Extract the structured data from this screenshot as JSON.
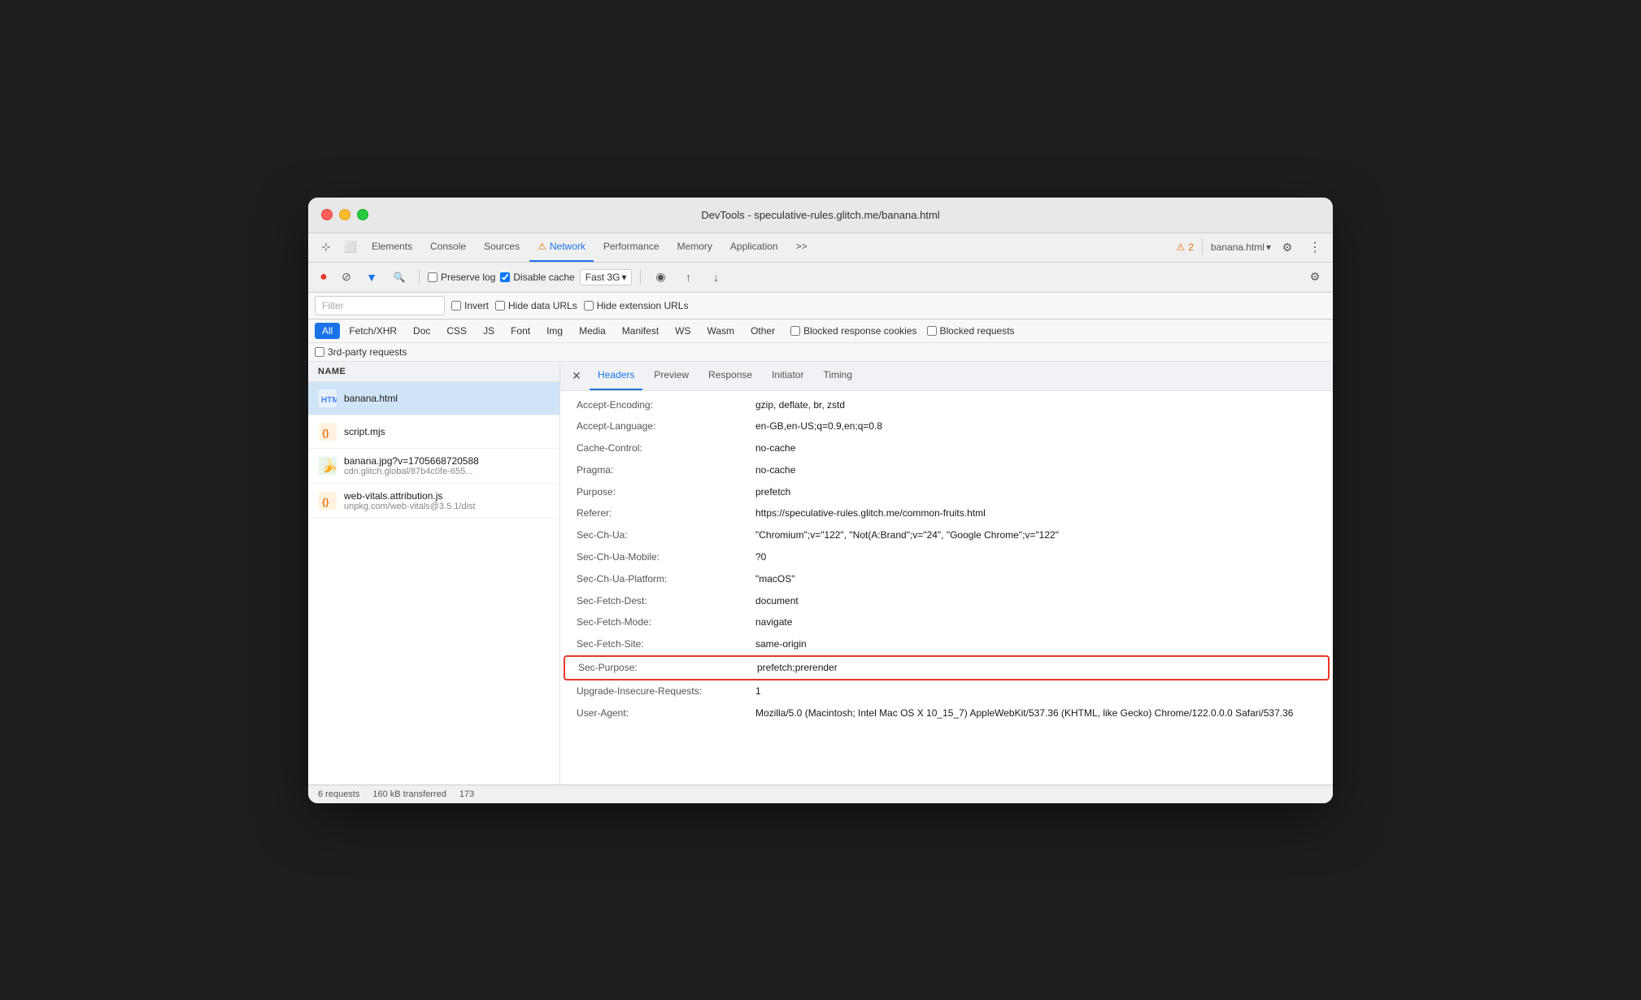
{
  "window": {
    "title": "DevTools - speculative-rules.glitch.me/banana.html"
  },
  "topToolbar": {
    "tabs": [
      {
        "label": "Elements",
        "active": false
      },
      {
        "label": "Console",
        "active": false
      },
      {
        "label": "Sources",
        "active": false
      },
      {
        "label": "Network",
        "active": true,
        "hasWarning": true
      },
      {
        "label": "Performance",
        "active": false
      },
      {
        "label": "Memory",
        "active": false
      },
      {
        "label": "Application",
        "active": false
      }
    ],
    "more_label": ">>",
    "warning_count": "2",
    "page_selector": "banana.html",
    "settings_label": "⚙",
    "more_icon_label": "⋮"
  },
  "secondToolbar": {
    "preserve_log_label": "Preserve log",
    "disable_cache_label": "Disable cache",
    "disable_cache_checked": true,
    "throttle_label": "Fast 3G"
  },
  "filterToolbar": {
    "filter_placeholder": "Filter",
    "invert_label": "Invert",
    "hide_data_urls_label": "Hide data URLs",
    "hide_extension_urls_label": "Hide extension URLs"
  },
  "filterTabs": {
    "tabs": [
      {
        "label": "All",
        "active": true
      },
      {
        "label": "Fetch/XHR",
        "active": false
      },
      {
        "label": "Doc",
        "active": false
      },
      {
        "label": "CSS",
        "active": false
      },
      {
        "label": "JS",
        "active": false
      },
      {
        "label": "Font",
        "active": false
      },
      {
        "label": "Img",
        "active": false
      },
      {
        "label": "Media",
        "active": false
      },
      {
        "label": "Manifest",
        "active": false
      },
      {
        "label": "WS",
        "active": false
      },
      {
        "label": "Wasm",
        "active": false
      },
      {
        "label": "Other",
        "active": false
      }
    ],
    "blocked_response_cookies_label": "Blocked response cookies",
    "blocked_requests_label": "Blocked requests"
  },
  "thirdParty": {
    "label": "3rd-party requests"
  },
  "fileList": {
    "header": "Name",
    "files": [
      {
        "name": "banana.html",
        "url": "",
        "icon_type": "html",
        "active": true
      },
      {
        "name": "script.mjs",
        "url": "",
        "icon_type": "js",
        "active": false
      },
      {
        "name": "banana.jpg?v=1705668720588",
        "url": "cdn.glitch.global/87b4c0fe-655...",
        "icon_type": "img",
        "active": false
      },
      {
        "name": "web-vitals.attribution.js",
        "url": "unpkg.com/web-vitals@3.5.1/dist",
        "icon_type": "js",
        "active": false
      }
    ]
  },
  "headersPanel": {
    "close_btn_label": "✕",
    "tabs": [
      {
        "label": "Headers",
        "active": true
      },
      {
        "label": "Preview",
        "active": false
      },
      {
        "label": "Response",
        "active": false
      },
      {
        "label": "Initiator",
        "active": false
      },
      {
        "label": "Timing",
        "active": false
      }
    ],
    "headers": [
      {
        "name": "Accept-Encoding:",
        "value": "gzip, deflate, br, zstd",
        "highlighted": false
      },
      {
        "name": "Accept-Language:",
        "value": "en-GB,en-US;q=0.9,en;q=0.8",
        "highlighted": false
      },
      {
        "name": "Cache-Control:",
        "value": "no-cache",
        "highlighted": false
      },
      {
        "name": "Pragma:",
        "value": "no-cache",
        "highlighted": false
      },
      {
        "name": "Purpose:",
        "value": "prefetch",
        "highlighted": false
      },
      {
        "name": "Referer:",
        "value": "https://speculative-rules.glitch.me/common-fruits.html",
        "highlighted": false
      },
      {
        "name": "Sec-Ch-Ua:",
        "value": "\"Chromium\";v=\"122\", \"Not(A:Brand\";v=\"24\", \"Google Chrome\";v=\"122\"",
        "highlighted": false
      },
      {
        "name": "Sec-Ch-Ua-Mobile:",
        "value": "?0",
        "highlighted": false
      },
      {
        "name": "Sec-Ch-Ua-Platform:",
        "value": "\"macOS\"",
        "highlighted": false
      },
      {
        "name": "Sec-Fetch-Dest:",
        "value": "document",
        "highlighted": false
      },
      {
        "name": "Sec-Fetch-Mode:",
        "value": "navigate",
        "highlighted": false
      },
      {
        "name": "Sec-Fetch-Site:",
        "value": "same-origin",
        "highlighted": false
      },
      {
        "name": "Sec-Purpose:",
        "value": "prefetch;prerender",
        "highlighted": true
      },
      {
        "name": "Upgrade-Insecure-Requests:",
        "value": "1",
        "highlighted": false
      },
      {
        "name": "User-Agent:",
        "value": "Mozilla/5.0 (Macintosh; Intel Mac OS X 10_15_7) AppleWebKit/537.36 (KHTML, like Gecko) Chrome/122.0.0.0 Safari/537.36",
        "highlighted": false
      }
    ]
  },
  "statusBar": {
    "requests": "6 requests",
    "transferred": "160 kB transferred",
    "other": "173"
  }
}
